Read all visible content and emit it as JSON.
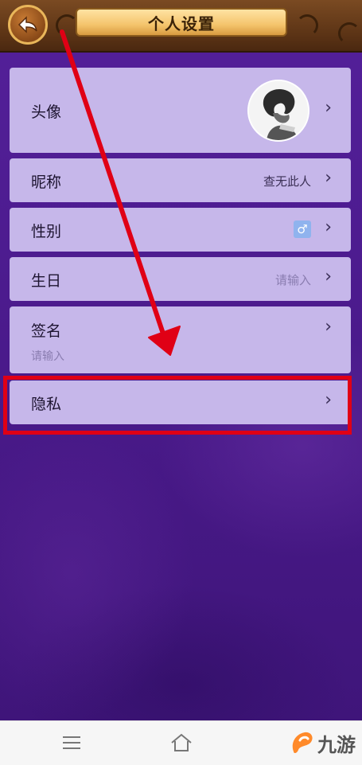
{
  "header": {
    "title": "个人设置",
    "back_icon": "back-arrow-icon"
  },
  "settings": {
    "avatar": {
      "label": "头像",
      "icon": "chevron-right-icon"
    },
    "nickname": {
      "label": "昵称",
      "value": "查无此人"
    },
    "gender": {
      "label": "性别",
      "value": "♂"
    },
    "birthday": {
      "label": "生日",
      "value": "请输入"
    },
    "signature": {
      "label": "签名",
      "value": "请输入"
    },
    "privacy": {
      "label": "隐私"
    },
    "chevron": "›"
  },
  "annotations": {
    "highlight_color": "#e00015",
    "arrow_color": "#e00015"
  },
  "navbar": {
    "icons": [
      "menu-icon",
      "home-icon",
      "back-icon"
    ]
  },
  "watermark": {
    "text": "九游"
  }
}
